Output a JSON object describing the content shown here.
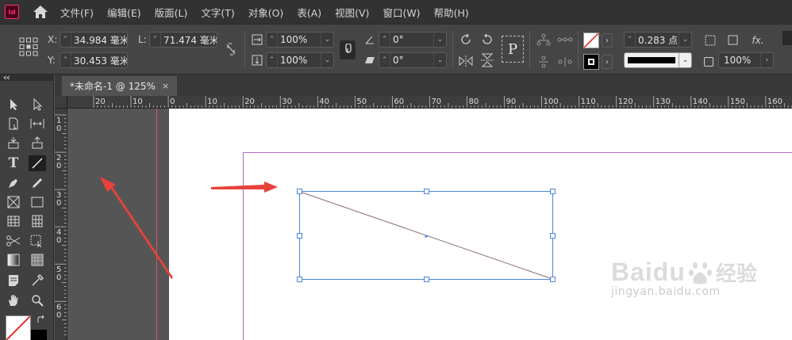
{
  "menubar": {
    "app_logo": "Id",
    "items": [
      "文件(F)",
      "编辑(E)",
      "版面(L)",
      "文字(T)",
      "对象(O)",
      "表(A)",
      "视图(V)",
      "窗口(W)",
      "帮助(H)"
    ]
  },
  "control": {
    "x_label": "X:",
    "x_value": "34.984 毫米",
    "y_label": "Y:",
    "y_value": "30.453 毫米",
    "l_label": "L:",
    "l_value": "71.474 毫米",
    "scale_x": "100%",
    "scale_y": "100%",
    "rotate": "0°",
    "shear": "0°",
    "stroke_weight": "0.283 点",
    "opacity": "100%",
    "fx_label": "fx."
  },
  "tab": {
    "title": "*未命名-1 @ 125%",
    "close": "×"
  },
  "ruler": {
    "h_labels": [
      "20",
      "10",
      "0",
      "10",
      "20",
      "30",
      "40",
      "50",
      "60",
      "70",
      "80",
      "90",
      "100",
      "110",
      "120",
      "130",
      "140",
      "150",
      "160"
    ],
    "v_labels": [
      "1 0",
      "2 0",
      "3 0",
      "4 0",
      "5 0",
      "6 0"
    ]
  },
  "colors": {
    "accent_arrow": "#e8423a",
    "selection": "#4a86d6",
    "margin_guide": "#b36ac0",
    "bleed_guide": "#d9576e"
  },
  "watermark": {
    "brand": "Baidu",
    "brand_cn": "经验",
    "url": "jingyan.baidu.com"
  }
}
